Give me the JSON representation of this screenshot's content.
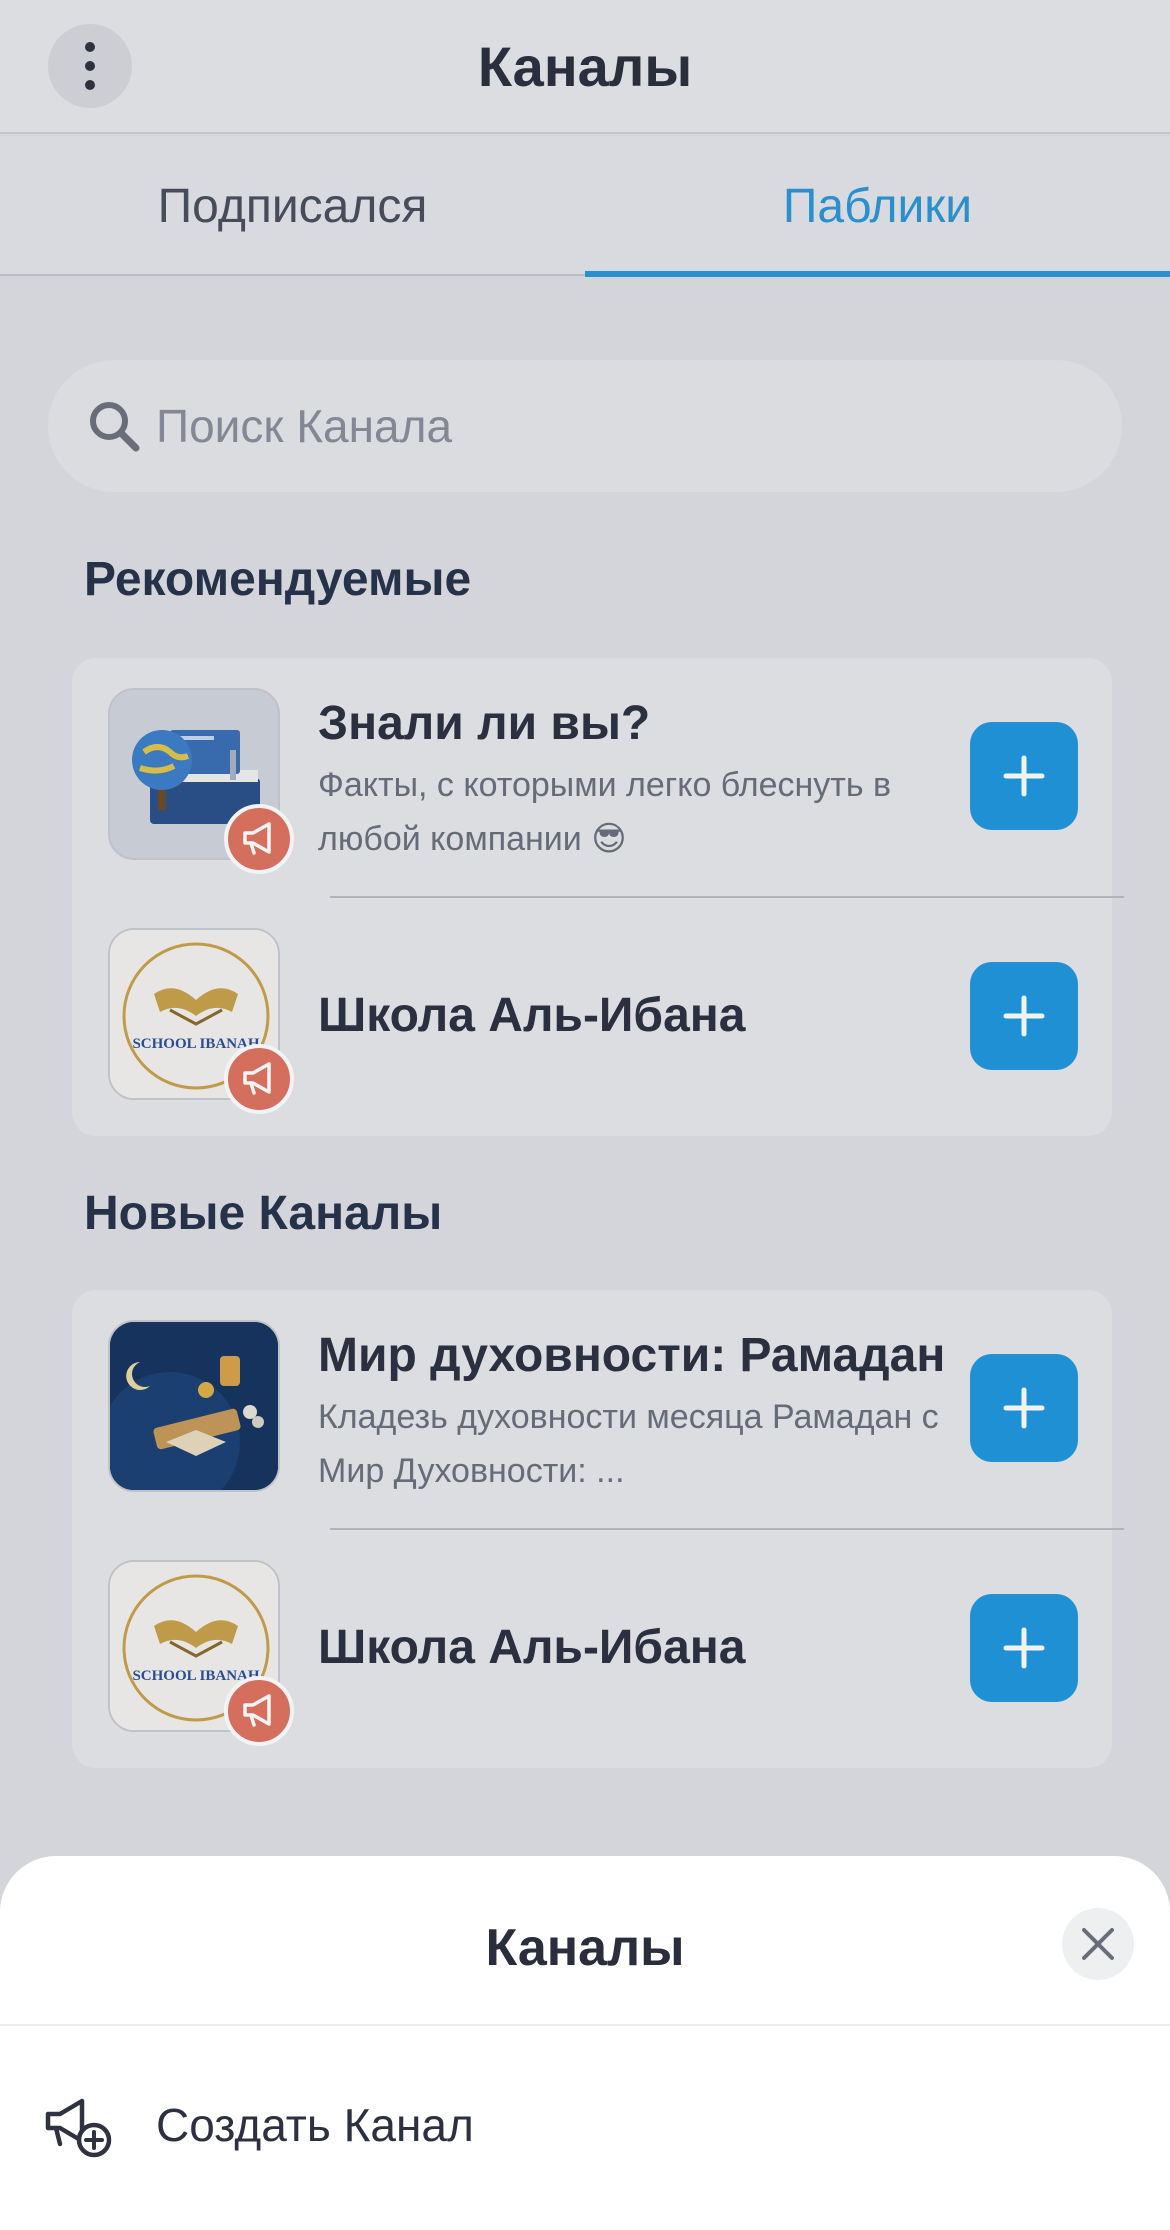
{
  "header": {
    "title": "Каналы"
  },
  "tabs": [
    {
      "label": "Подписался",
      "active": false
    },
    {
      "label": "Паблики",
      "active": true
    }
  ],
  "search": {
    "placeholder": "Поиск Канала",
    "value": ""
  },
  "sections": {
    "recommended": {
      "title": "Рекомендуемые",
      "items": [
        {
          "title": "Знали ли вы?",
          "description": "Факты, с которыми легко блеснуть в любой компании 😎",
          "avatar": "globe-books"
        },
        {
          "title": "Школа Аль-Ибана",
          "description": "",
          "avatar": "school-ibanah-logo",
          "logo_text": "SCHOOL IBANAH"
        }
      ]
    },
    "new": {
      "title": "Новые Каналы",
      "items": [
        {
          "title": "Мир духовности: Рамадан",
          "description": "Кладезь духовности месяца Рамадан с Мир Духовности: ...",
          "avatar": "ramadan-night"
        },
        {
          "title": "Школа Аль-Ибана",
          "description": "",
          "avatar": "school-ibanah-logo",
          "logo_text": "SCHOOL IBANAH"
        }
      ]
    }
  },
  "sheet": {
    "title": "Каналы",
    "items": [
      {
        "label": "Создать Канал",
        "icon": "megaphone-plus-icon"
      }
    ]
  },
  "colors": {
    "accent": "#1f96de",
    "active_tab": "#2a95d6",
    "badge": "#e0725f",
    "background": "#dfe0e4",
    "card": "#e7e8eb"
  }
}
